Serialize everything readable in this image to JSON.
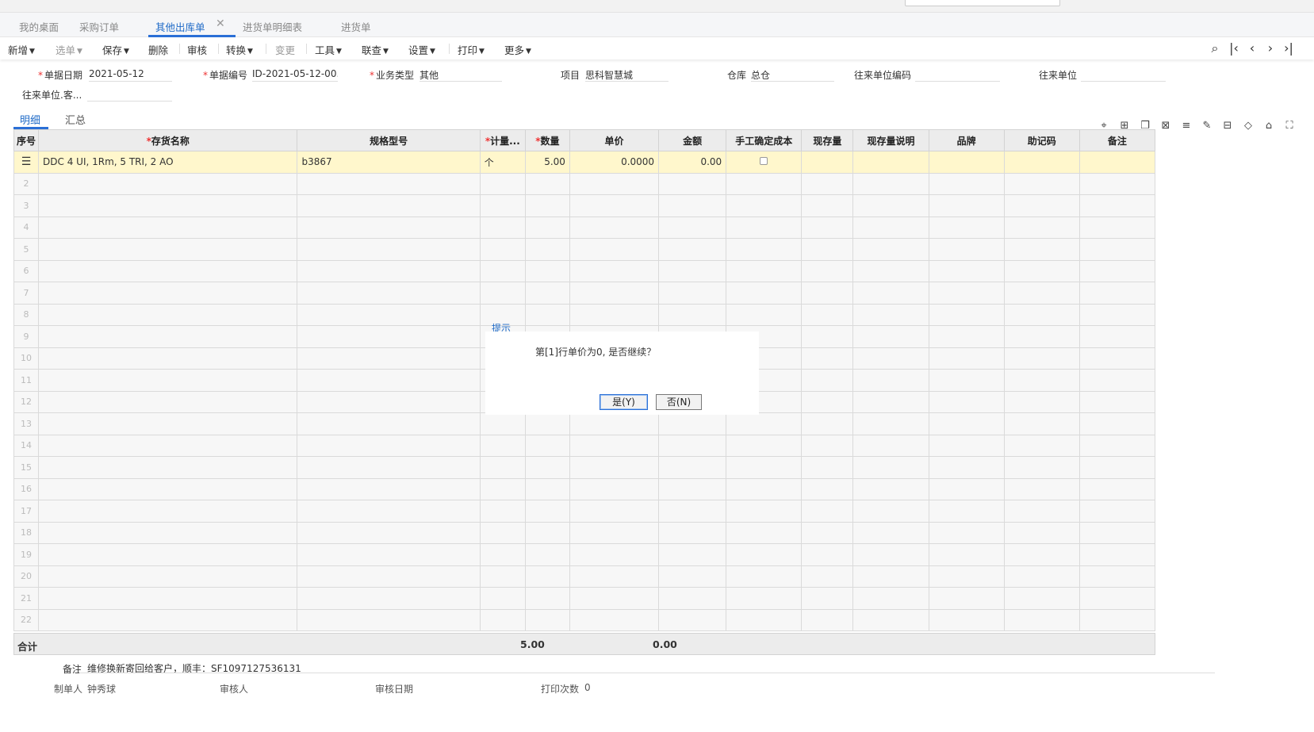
{
  "tabs": [
    {
      "label": "我的桌面",
      "active": false
    },
    {
      "label": "采购订单",
      "active": false
    },
    {
      "label": "其他出库单",
      "active": true
    },
    {
      "label": "进货单明细表",
      "active": false
    },
    {
      "label": "进货单",
      "active": false
    }
  ],
  "toolbar": {
    "add": "新增",
    "select": "选单",
    "save": "保存",
    "delete": "删除",
    "audit": "审核",
    "convert": "转换",
    "change": "变更",
    "tools": "工具",
    "link": "联查",
    "settings": "设置",
    "print": "打印",
    "more": "更多"
  },
  "form": {
    "date_label": "单据日期",
    "date": "2021-05-12",
    "code_label": "单据编号",
    "code": "ID-2021-05-12-00...",
    "biz_label": "业务类型",
    "biz": "其他",
    "project_label": "项目",
    "project": "思科智慧城",
    "warehouse_label": "仓库",
    "warehouse": "总仓",
    "partner_code_label": "往来单位编码",
    "partner_code": "",
    "partner_label": "往来单位",
    "partner": "",
    "partner_cust_label": "往来单位.客...",
    "partner_cust": ""
  },
  "subtabs": {
    "detail": "明细",
    "summary": "汇总"
  },
  "grid": {
    "headers": [
      "序号",
      "存货名称",
      "规格型号",
      "计量...",
      "数量",
      "单价",
      "金额",
      "手工确定成本",
      "现存量",
      "现存量说明",
      "品牌",
      "助记码",
      "备注"
    ],
    "rows": [
      {
        "name": "DDC 4 UI, 1Rm, 5 TRI, 2 AO",
        "spec": "b3867",
        "unit": "个",
        "qty": "5.00",
        "price": "0.0000",
        "amount": "0.00"
      }
    ],
    "row_numbers": [
      "2",
      "3",
      "4",
      "5",
      "6",
      "7",
      "8",
      "9",
      "10",
      "11",
      "12",
      "13",
      "14",
      "15",
      "16",
      "17",
      "18",
      "19",
      "20",
      "21",
      "22"
    ]
  },
  "totals": {
    "label": "合计",
    "qty": "5.00",
    "amount": "0.00"
  },
  "footer": {
    "remark_label": "备注",
    "remark": "维修换新寄回给客户，顺丰：SF1097127536131",
    "maker_label": "制单人",
    "maker": "钟秀球",
    "auditor_label": "审核人",
    "auditor": "",
    "audit_date_label": "审核日期",
    "audit_date": "",
    "print_count_label": "打印次数",
    "print_count": "0"
  },
  "dialog": {
    "title": "提示",
    "message": "第[1]行单价为0, 是否继续？",
    "yes": "是(Y)",
    "no": "否(N)"
  }
}
